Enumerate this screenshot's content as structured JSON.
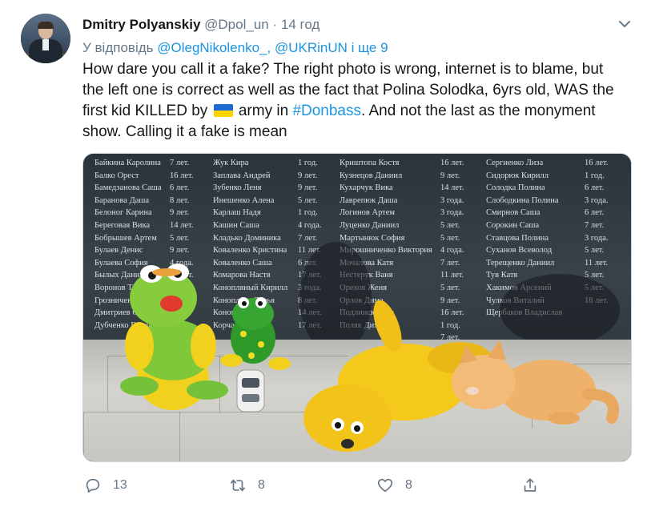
{
  "tweet": {
    "author_name": "Dmitry Polyanskiy",
    "handle": "@Dpol_un",
    "separator": "·",
    "time": "14 год",
    "reply_prefix": "У відповідь",
    "reply_user1": "@OlegNikolenko_,",
    "reply_user2": "@UKRinUN",
    "reply_more": "і ще 9",
    "text_part1": "How dare you call it a fake? The right photo is wrong, internet is to blame, but the left one is correct as well as the fact that Polina Solodka, 6yrs old, WAS the first kid KILLED by",
    "text_part2": "army in",
    "hashtag": "#Donbass",
    "text_part3": ". And not the last as the monyment show. Calling it a fake is mean"
  },
  "photo": {
    "memorial_col1": "Байкина Каролина\nБалко Орест\nБамедзанова Саша\nБаранова Даша\nБелоног Карина\nБереговая Вика\nБобрышев Артем\nБулаев Денис\nБулаева София\nБылых Данила\nВоронов Тимофей\nГрозниченко Вит\nДмитриев Серг\nДубченко Влади",
    "memorial_col1b": "7 лет.\n16 лет.\n6 лет.\n8 лет.\n9 лет.\n14 лет.\n5 лет.\n9 лет.\n4 года.\n15 лет.",
    "memorial_col2": "Жук Кира\nЗаплава Андрей\nЗубенко Леня\nИнешенко Алена\nКарлаш Надя\nКашин Саша\nКладько Доминика\nКоваленко Кристина\nКоваленко Саша\nКомарова Настя\nКонопляный Кирилл\nКоноплева Дарья\nКонопле\nКорчак",
    "memorial_col2b": "1 год.\n9 лет.\n9 лет.\n5 лет.\n1 год.\n4 года.\n7 лет.\n11 лет.\n6 лет.\n17 лет.\n3 года.\n8 лет.\n14 лет.\n17 лет.",
    "memorial_col3": "Криштопа Костя\nКузнецов Даниил\nКухарчук Вика\nЛаврепюк Даша\nЛогинов Артем\nЛуценко Даниил\nМартынюк София\nМирошниченко Виктория\nМочалова Катя\nНестерук Ваня\nОрехов Женя\nОрлов Дима\nПодлинская На\nПоляк Дима",
    "memorial_col3b": "16 лет.\n9 лет.\n14 лет.\n3 года.\n3 года.\n5 лет.\n5 лет.\n4 года.\n7 лет.\n11 лет.\n5 лет.\n9 лет.\n16 лет.\n1 год.\n7 лет.",
    "memorial_col4": "Сергиенко Лиза\nСидорюк Кирилл\nСолодка Полина\nСлободкина Полина\nСмирнов Саша\nСорокин Саша\nСтавцова Полина\nСуханов Всеволод\nТерещенко Даниил\nТув Катя\nХакимов Арсений\nЧулков Виталий\nЩербаков Владислав",
    "memorial_col4b": "16 лет.\n1 год.\n6 лет.\n3 года.\n6 лет.\n7 лет.\n3 года.\n5 лет.\n11 лет.\n5 лет.\n5 лет.\n18 лет."
  },
  "actions": {
    "reply_count": "13",
    "retweet_count": "8",
    "like_count": "8"
  },
  "icons": [
    "chevron-down-icon",
    "reply-icon",
    "retweet-icon",
    "like-icon",
    "share-icon"
  ],
  "colors": {
    "link": "#1b95e0",
    "muted": "#657786",
    "text": "#14171a"
  }
}
